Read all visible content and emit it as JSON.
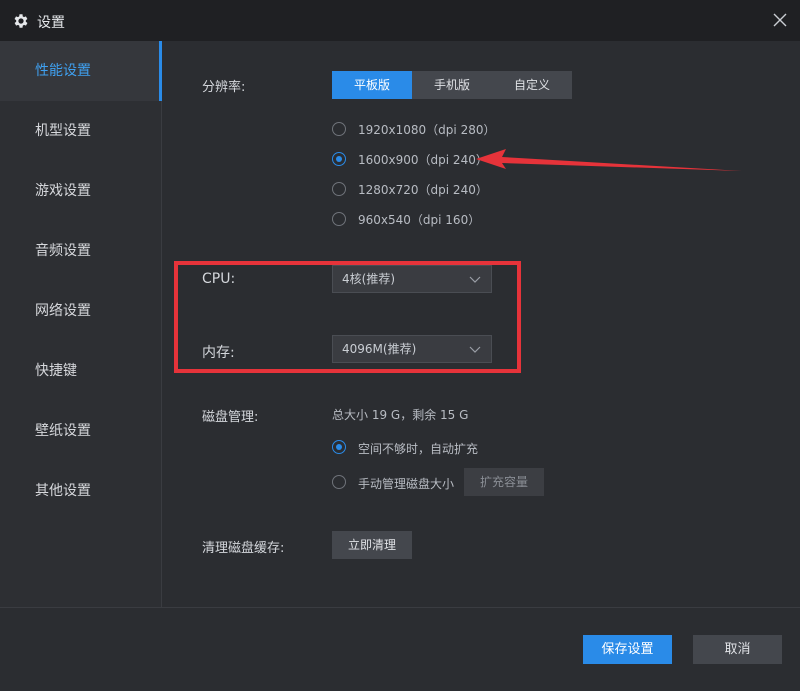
{
  "window": {
    "title": "设置"
  },
  "sidebar": {
    "items": [
      {
        "label": "性能设置",
        "active": true
      },
      {
        "label": "机型设置"
      },
      {
        "label": "游戏设置"
      },
      {
        "label": "音频设置"
      },
      {
        "label": "网络设置"
      },
      {
        "label": "快捷键"
      },
      {
        "label": "壁纸设置"
      },
      {
        "label": "其他设置"
      }
    ]
  },
  "resolution": {
    "label": "分辨率:",
    "tabs": [
      {
        "label": "平板版",
        "active": true
      },
      {
        "label": "手机版"
      },
      {
        "label": "自定义"
      }
    ],
    "options": [
      {
        "label": "1920x1080（dpi 280）",
        "selected": false
      },
      {
        "label": "1600x900（dpi 240）",
        "selected": true
      },
      {
        "label": "1280x720（dpi 240）",
        "selected": false
      },
      {
        "label": "960x540（dpi 160）",
        "selected": false
      }
    ]
  },
  "cpu": {
    "label": "CPU:",
    "value": "4核(推荐)"
  },
  "memory": {
    "label": "内存:",
    "value": "4096M(推荐)"
  },
  "disk": {
    "label": "磁盘管理:",
    "summary": "总大小 19 G，剩余 15 G",
    "options": [
      {
        "label": "空间不够时，自动扩充",
        "selected": true
      },
      {
        "label": "手动管理磁盘大小",
        "selected": false
      }
    ],
    "expand_button": "扩充容量"
  },
  "cache": {
    "label": "清理磁盘缓存:",
    "button": "立即清理"
  },
  "footer": {
    "save": "保存设置",
    "cancel": "取消"
  },
  "colors": {
    "accent": "#2a8be8",
    "annotation": "#e6333a"
  }
}
